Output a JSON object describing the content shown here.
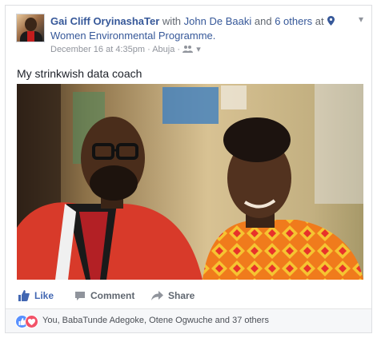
{
  "post": {
    "author": "Gai Cliff OryinashaTer",
    "with_word": "with",
    "tagged_person": "John De Baaki",
    "and_word": "and",
    "others": "6 others",
    "at_word": "at",
    "location": "Women Environmental Programme.",
    "timestamp": "December 16 at 4:35pm",
    "place": "Abuja",
    "separator": "·",
    "caption": "My strinkwish data coach"
  },
  "actions": {
    "like": "Like",
    "comment": "Comment",
    "share": "Share"
  },
  "reactions": {
    "summary": "You, BabaTunde Adegoke, Otene Ogwuche and 37 others",
    "icons": [
      "like-reaction-icon",
      "love-reaction-icon"
    ]
  },
  "colors": {
    "link": "#365899",
    "like_blue": "#4267b2",
    "meta_gray": "#90949c"
  }
}
